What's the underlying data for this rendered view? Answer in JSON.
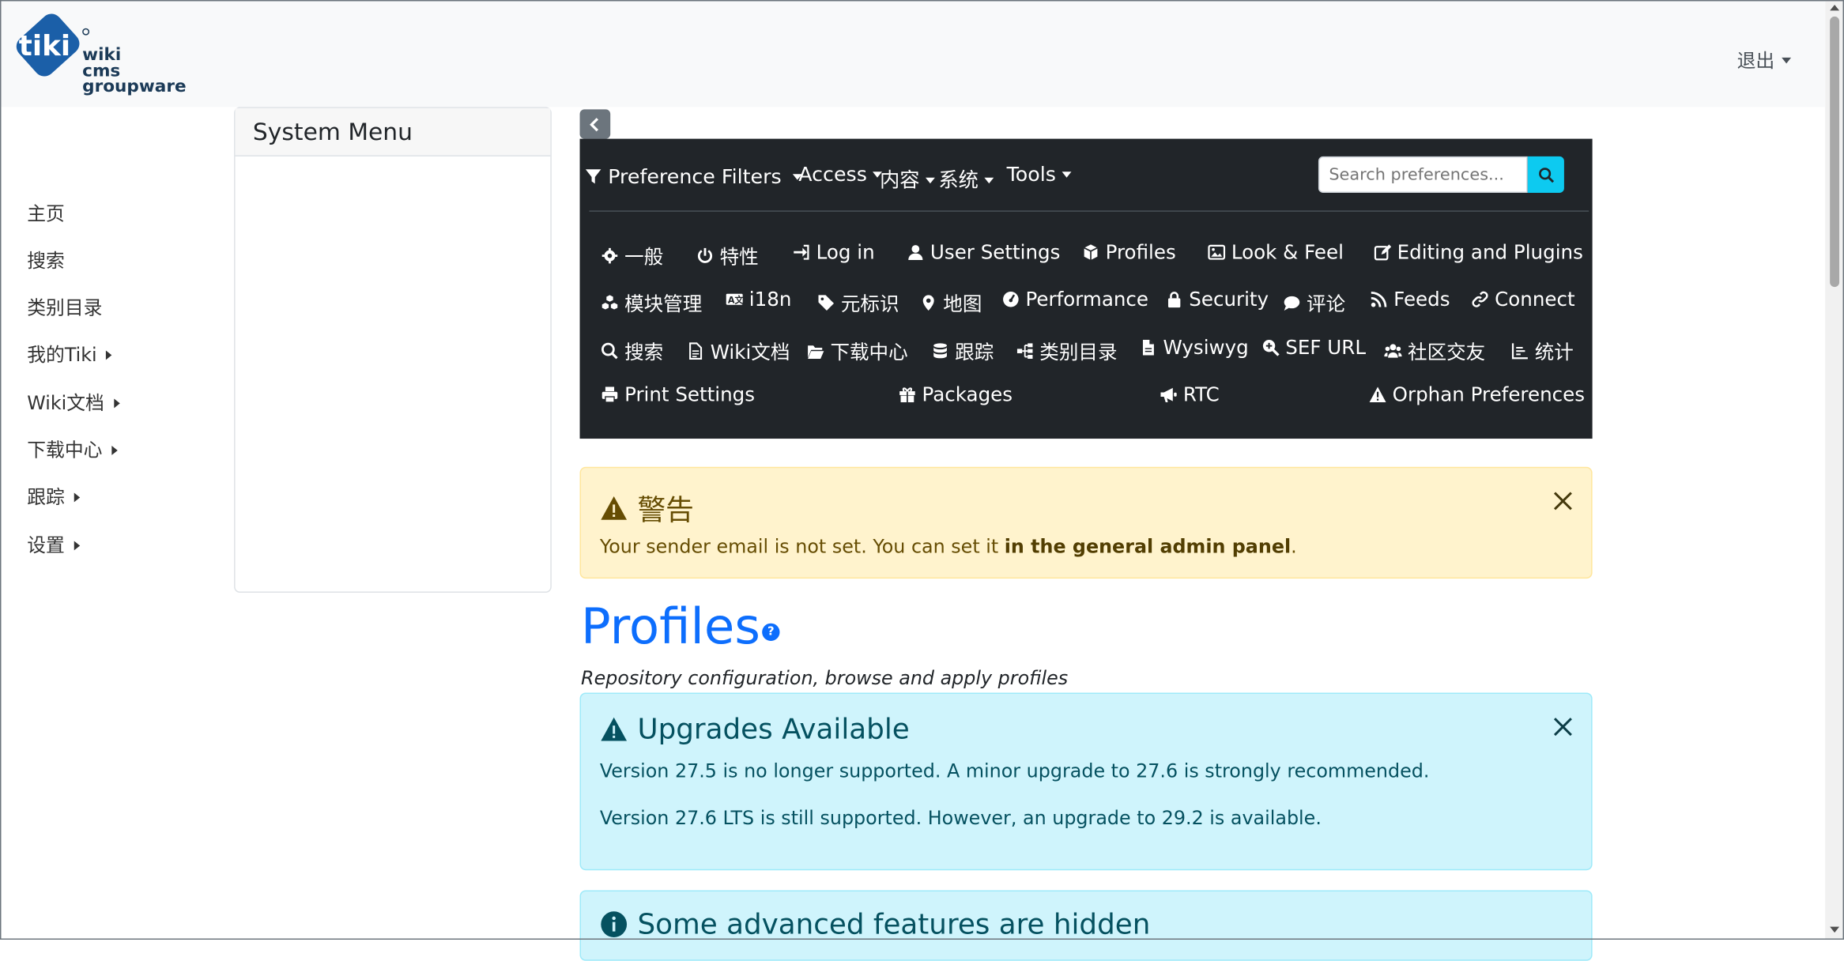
{
  "logo": {
    "line1": "wiki",
    "line2": "cms",
    "line3": "groupware"
  },
  "header": {
    "logout_label": "退出"
  },
  "sidebar": {
    "title": "System Menu",
    "items": [
      {
        "label": "主页",
        "has_submenu": false
      },
      {
        "label": "搜索",
        "has_submenu": false
      },
      {
        "label": "类别目录",
        "has_submenu": false
      },
      {
        "label": "我的Tiki",
        "has_submenu": true
      },
      {
        "label": "Wiki文档",
        "has_submenu": true
      },
      {
        "label": "下载中心",
        "has_submenu": true
      },
      {
        "label": "跟踪",
        "has_submenu": true
      },
      {
        "label": "设置",
        "has_submenu": true
      }
    ]
  },
  "nav": {
    "filters_label": "Preference Filters",
    "menus": [
      "Access",
      "内容",
      "系统",
      "Tools"
    ],
    "search_placeholder": "Search preferences...",
    "links": [
      {
        "label": "一般",
        "icon": "gear-icon"
      },
      {
        "label": "特性",
        "icon": "power-icon"
      },
      {
        "label": "Log in",
        "icon": "sign-in-icon"
      },
      {
        "label": "User Settings",
        "icon": "user-icon"
      },
      {
        "label": "Profiles",
        "icon": "cube-icon"
      },
      {
        "label": "Look & Feel",
        "icon": "image-icon"
      },
      {
        "label": "Editing and Plugins",
        "icon": "edit-icon"
      },
      {
        "label": "模块管理",
        "icon": "cubes-icon"
      },
      {
        "label": "i18n",
        "icon": "language-icon"
      },
      {
        "label": "元标识",
        "icon": "tag-icon"
      },
      {
        "label": "地图",
        "icon": "map-marker-icon"
      },
      {
        "label": "Performance",
        "icon": "tachometer-icon"
      },
      {
        "label": "Security",
        "icon": "lock-icon"
      },
      {
        "label": "评论",
        "icon": "comment-icon"
      },
      {
        "label": "Feeds",
        "icon": "rss-icon"
      },
      {
        "label": "Connect",
        "icon": "link-icon"
      },
      {
        "label": "搜索",
        "icon": "search-icon"
      },
      {
        "label": "Wiki文档",
        "icon": "file-text-icon"
      },
      {
        "label": "下载中心",
        "icon": "folder-open-icon"
      },
      {
        "label": "跟踪",
        "icon": "database-icon"
      },
      {
        "label": "类别目录",
        "icon": "sitemap-icon"
      },
      {
        "label": "Wysiwyg",
        "icon": "file-icon"
      },
      {
        "label": "SEF URL",
        "icon": "search-plus-icon"
      },
      {
        "label": "社区交友",
        "icon": "users-icon"
      },
      {
        "label": "统计",
        "icon": "chart-icon"
      },
      {
        "label": "Print Settings",
        "icon": "print-icon"
      },
      {
        "label": "Packages",
        "icon": "gift-icon"
      },
      {
        "label": "RTC",
        "icon": "bullhorn-icon"
      },
      {
        "label": "Orphan Preferences",
        "icon": "warning-icon"
      }
    ]
  },
  "warning_alert": {
    "title": "警告",
    "text_before": "Your sender email is not set. You can set it ",
    "link_text": "in the general admin panel",
    "text_after": "."
  },
  "page": {
    "title": "Profiles",
    "help": "?",
    "subtitle": "Repository configuration, browse and apply profiles"
  },
  "upgrade_alert": {
    "title": "Upgrades Available",
    "line1": "Version 27.5 is no longer supported. A minor upgrade to 27.6 is strongly recommended.",
    "line2": "Version 27.6 LTS is still supported. However, an upgrade to 29.2 is available."
  },
  "hidden_alert": {
    "title": "Some advanced features are hidden"
  }
}
